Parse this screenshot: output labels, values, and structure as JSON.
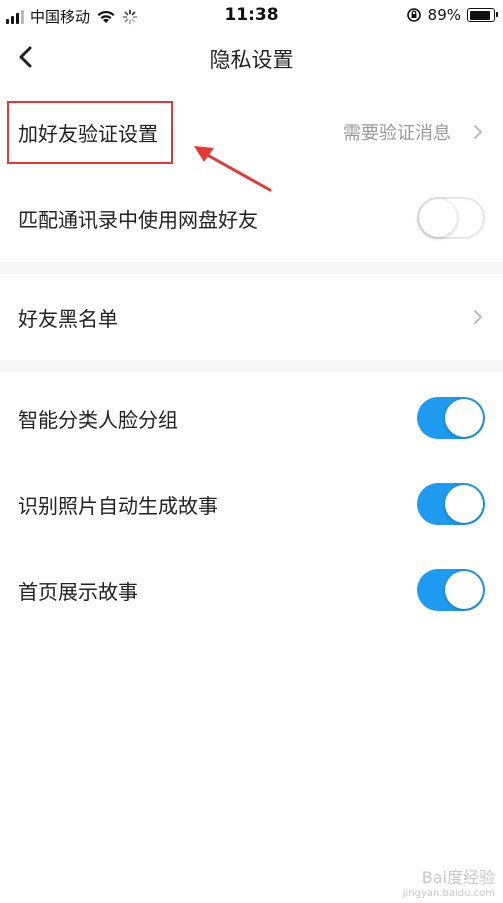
{
  "status": {
    "carrier": "中国移动",
    "time": "11:38",
    "battery": "89%",
    "battery_level": 0.89
  },
  "nav": {
    "title": "隐私设置"
  },
  "settings": {
    "add_friend_verify": {
      "label": "加好友验证设置",
      "value": "需要验证消息"
    },
    "match_contacts": {
      "label": "匹配通讯录中使用网盘好友",
      "enabled": false
    },
    "friend_blacklist": {
      "label": "好友黑名单"
    },
    "smart_face_group": {
      "label": "智能分类人脸分组",
      "enabled": true
    },
    "photo_story": {
      "label": "识别照片自动生成故事",
      "enabled": true
    },
    "home_story": {
      "label": "首页展示故事",
      "enabled": true
    }
  },
  "colors": {
    "toggle_on": "#1e9bf0",
    "annotation": "#e53935"
  },
  "watermark": {
    "text": "Bai度经验",
    "sub": "jingyan.baidu.com"
  }
}
